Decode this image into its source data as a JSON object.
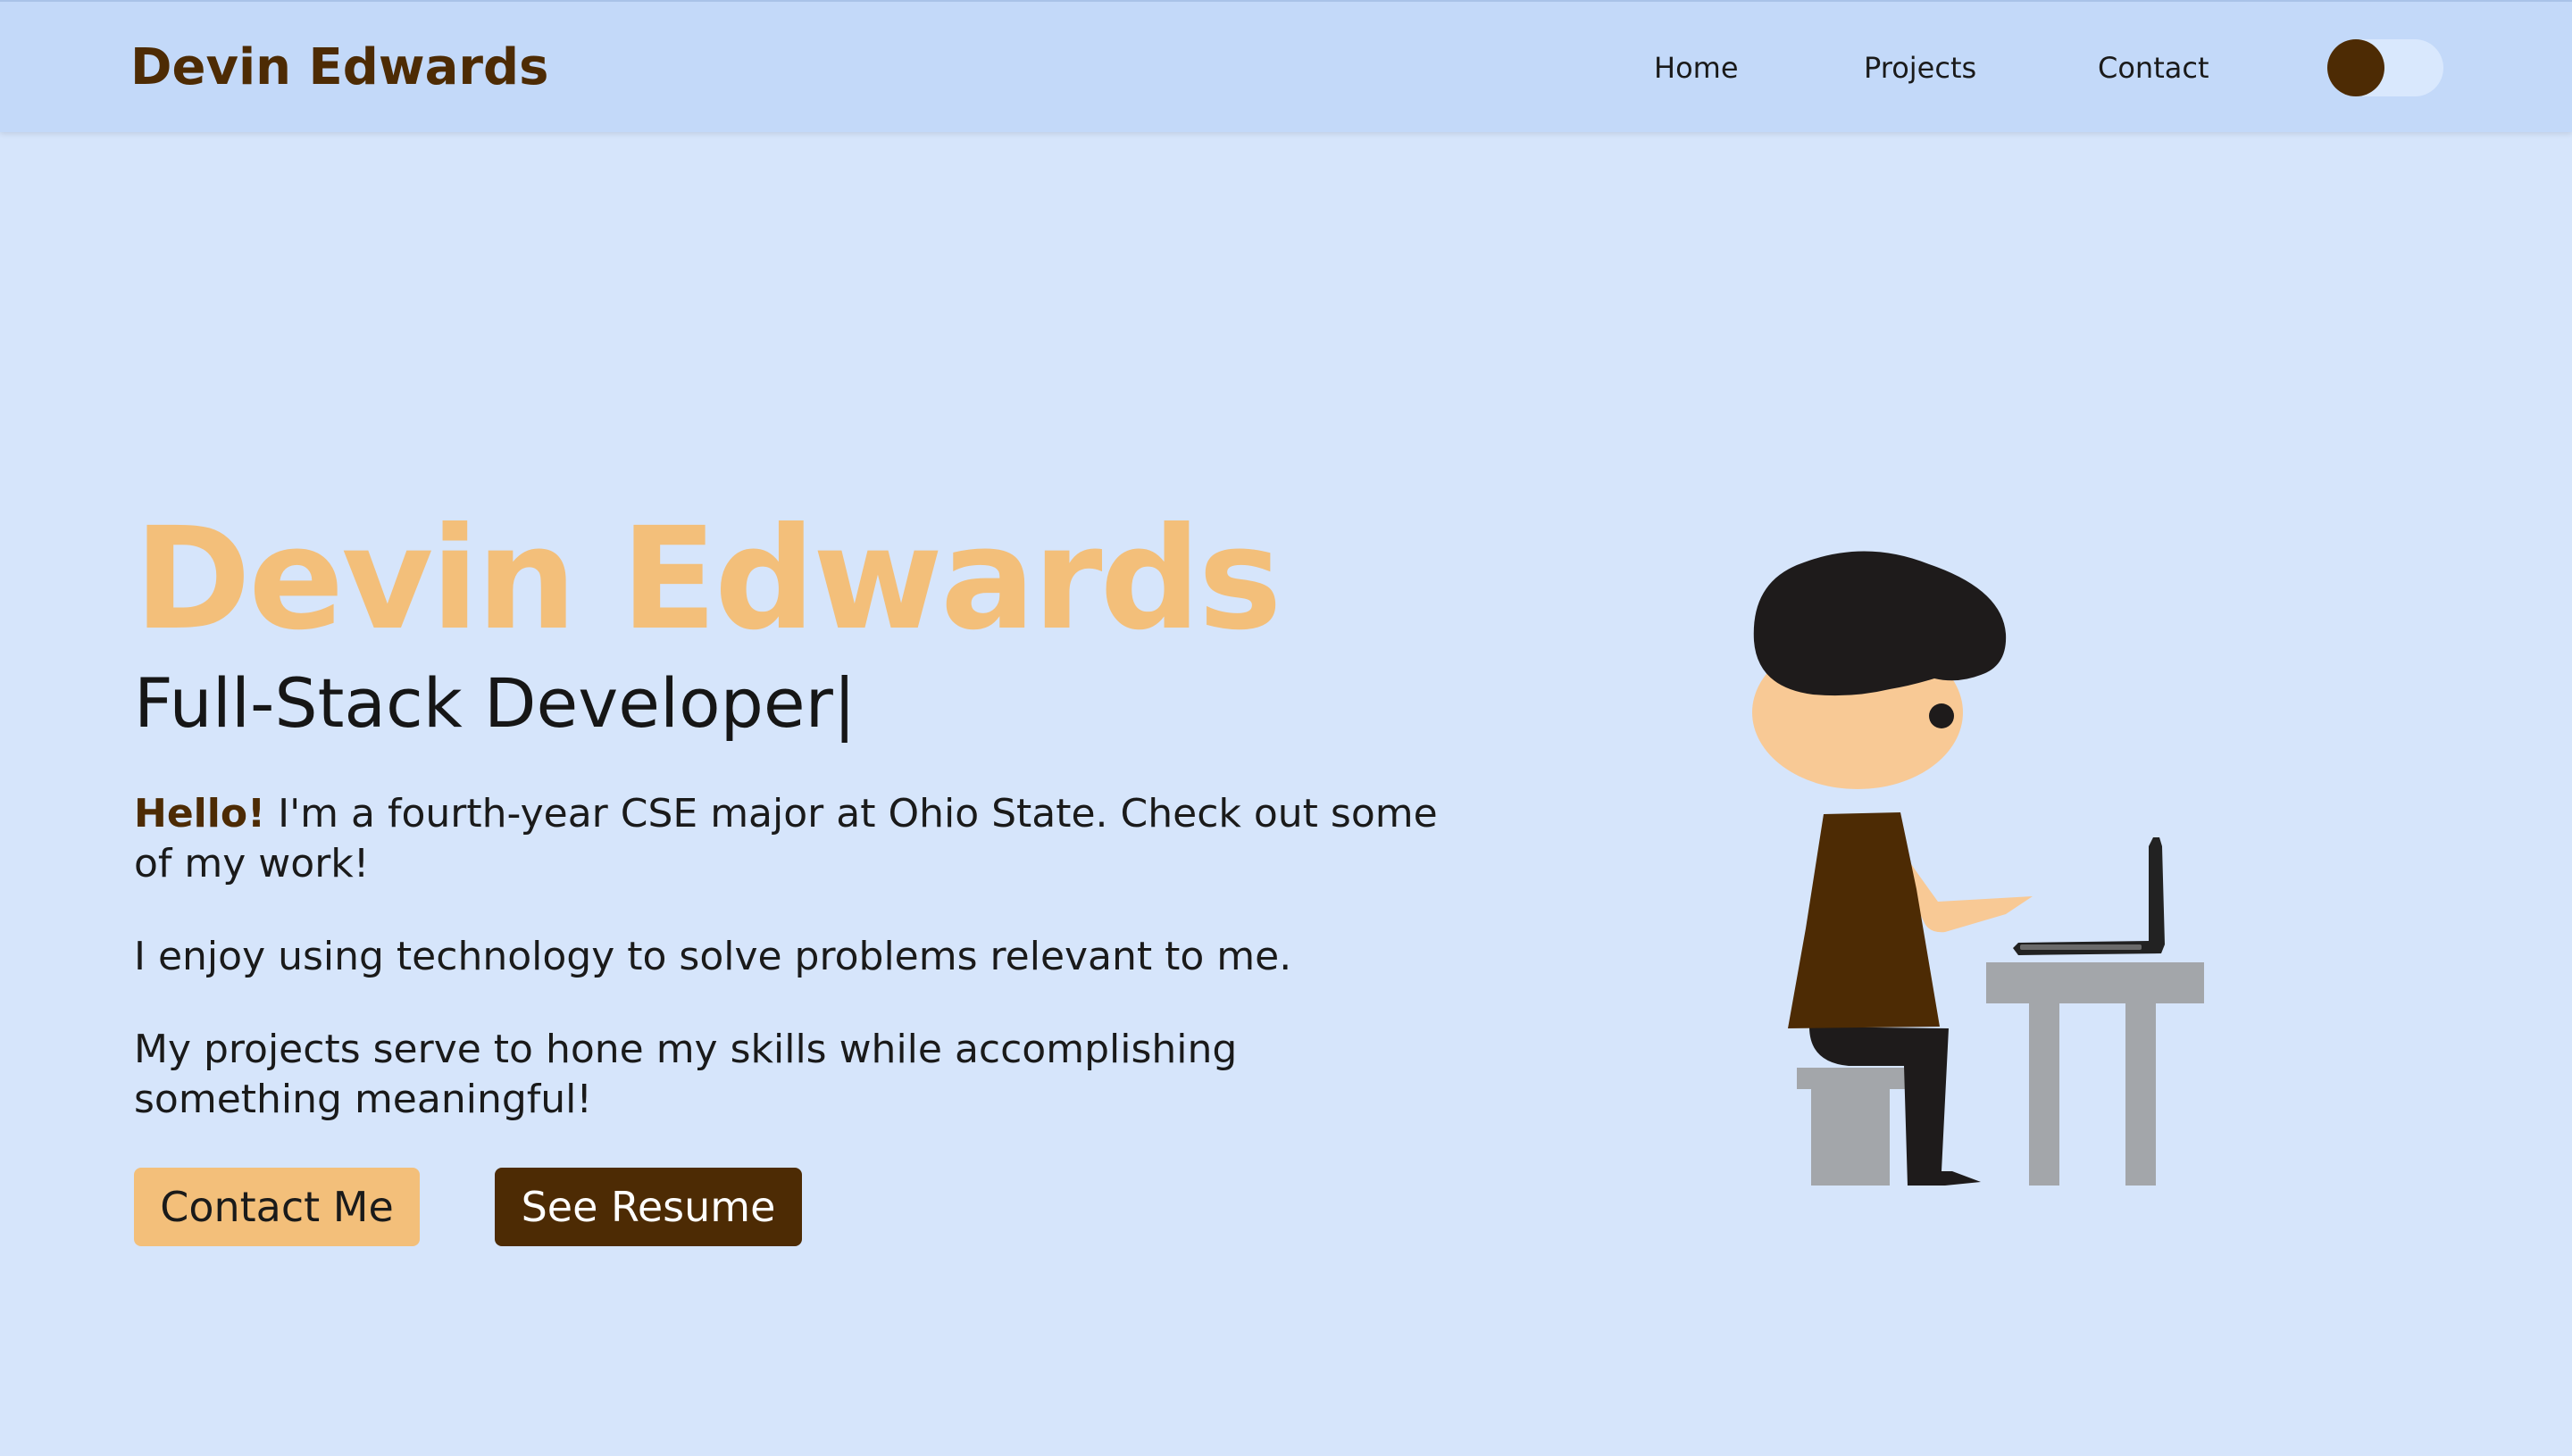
{
  "header": {
    "brand": "Devin Edwards",
    "nav": {
      "home": "Home",
      "projects": "Projects",
      "contact": "Contact"
    }
  },
  "hero": {
    "name": "Devin Edwards",
    "role": "Full-Stack Developer|",
    "intro_highlight": "Hello!",
    "intro_rest": " I'm a fourth-year CSE major at Ohio State. Check out some of my work!",
    "paragraph2": "I enjoy using technology to solve problems relevant to me.",
    "paragraph3": "My projects serve to hone my skills while accomplishing something meaningful!",
    "buttons": {
      "contact": "Contact Me",
      "resume": "See Resume"
    }
  },
  "colors": {
    "background": "#d6e5fb",
    "navbar": "#c3d9f9",
    "accent_brown": "#4d2b04",
    "accent_orange": "#f3bf7a"
  }
}
